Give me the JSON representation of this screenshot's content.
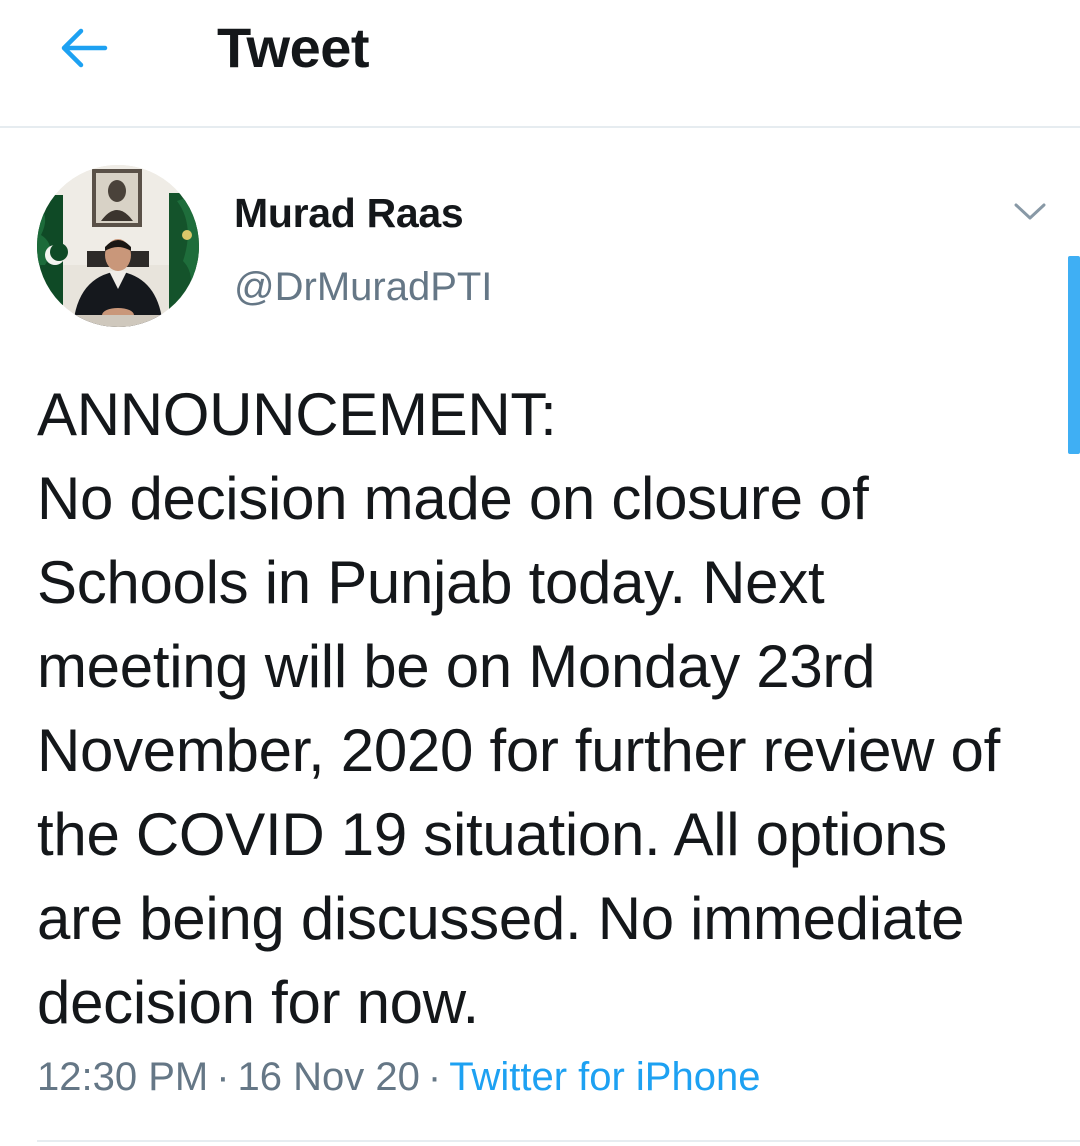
{
  "header": {
    "back_icon": "arrow-left-icon",
    "title": "Tweet"
  },
  "tweet": {
    "author": {
      "name": "Murad Raas",
      "handle": "@DrMuradPTI",
      "avatar": "avatar-photo"
    },
    "caret_icon": "chevron-down-icon",
    "text": "ANNOUNCEMENT:\nNo decision made on closure of Schools in Punjab today. Next meeting will be on Monday 23rd November, 2020 for further review of the COVID 19 situation. All options are being discussed. No immediate decision for now.",
    "time": "12:30 PM",
    "separator": "·",
    "date": "16 Nov 20",
    "source": "Twitter for iPhone"
  },
  "colors": {
    "accent": "#1da1f2",
    "text": "#14171a",
    "secondary": "#657786",
    "divider": "#e6ecf0"
  }
}
